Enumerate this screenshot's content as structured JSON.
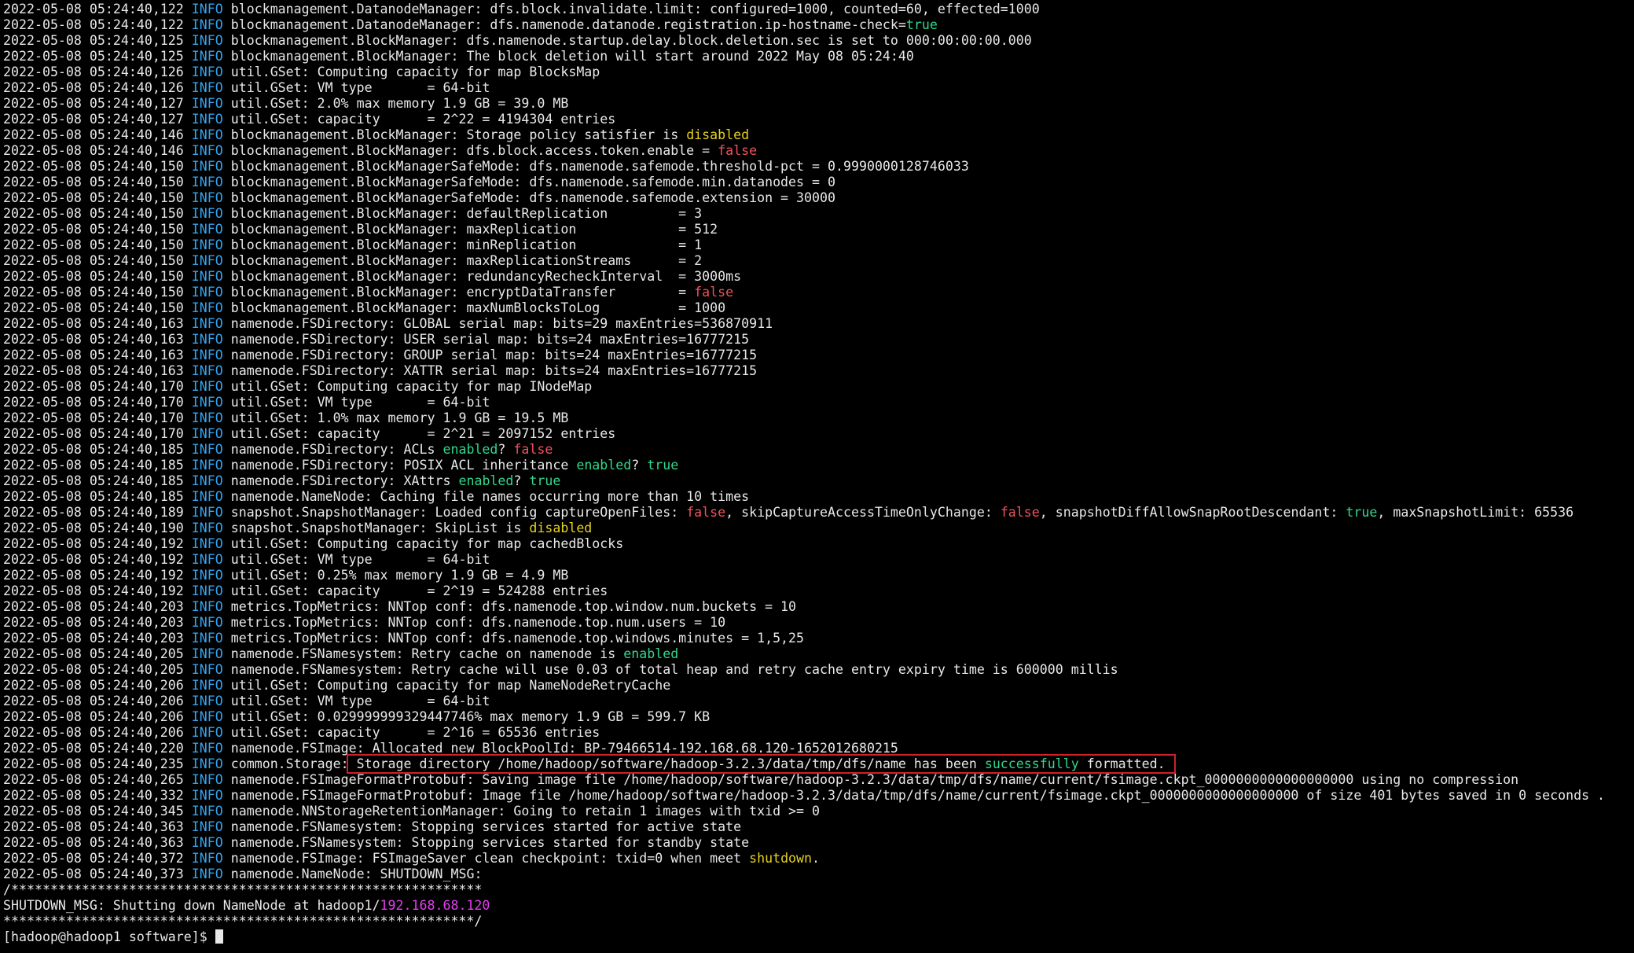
{
  "colors": {
    "background": "#000000",
    "text": "#e8e8e8",
    "level": "#35a4f0",
    "green": "#2fd88c",
    "red": "#f0525a",
    "yellow": "#e6d21f",
    "magenta": "#e33ef0",
    "highlight_box": "#d0202a"
  },
  "prompt": "[hadoop@hadoop1 software]$ ",
  "lines": [
    {
      "ts": "2022-05-08 05:24:40,122",
      "level": "INFO",
      "segs": [
        {
          "t": " blockmanagement.DatanodeManager: dfs.block.invalidate.limit: configured=1000, counted=60, effected=1000"
        }
      ]
    },
    {
      "ts": "2022-05-08 05:24:40,122",
      "level": "INFO",
      "segs": [
        {
          "t": " blockmanagement.DatanodeManager: dfs.namenode.datanode.registration.ip-hostname-check="
        },
        {
          "t": "true",
          "c": "green"
        }
      ]
    },
    {
      "ts": "2022-05-08 05:24:40,125",
      "level": "INFO",
      "segs": [
        {
          "t": " blockmanagement.BlockManager: dfs.namenode.startup.delay.block.deletion.sec is set to 000:00:00:00.000"
        }
      ]
    },
    {
      "ts": "2022-05-08 05:24:40,125",
      "level": "INFO",
      "segs": [
        {
          "t": " blockmanagement.BlockManager: The block deletion will start around 2022 May 08 05:24:40"
        }
      ]
    },
    {
      "ts": "2022-05-08 05:24:40,126",
      "level": "INFO",
      "segs": [
        {
          "t": " util.GSet: Computing capacity for map BlocksMap"
        }
      ]
    },
    {
      "ts": "2022-05-08 05:24:40,126",
      "level": "INFO",
      "segs": [
        {
          "t": " util.GSet: VM type       = 64-bit"
        }
      ]
    },
    {
      "ts": "2022-05-08 05:24:40,127",
      "level": "INFO",
      "segs": [
        {
          "t": " util.GSet: 2.0% max memory 1.9 GB = 39.0 MB"
        }
      ]
    },
    {
      "ts": "2022-05-08 05:24:40,127",
      "level": "INFO",
      "segs": [
        {
          "t": " util.GSet: capacity      = 2^22 = 4194304 entries"
        }
      ]
    },
    {
      "ts": "2022-05-08 05:24:40,146",
      "level": "INFO",
      "segs": [
        {
          "t": " blockmanagement.BlockManager: Storage policy satisfier is "
        },
        {
          "t": "disabled",
          "c": "yellow"
        }
      ]
    },
    {
      "ts": "2022-05-08 05:24:40,146",
      "level": "INFO",
      "segs": [
        {
          "t": " blockmanagement.BlockManager: dfs.block.access.token.enable = "
        },
        {
          "t": "false",
          "c": "red"
        }
      ]
    },
    {
      "ts": "2022-05-08 05:24:40,150",
      "level": "INFO",
      "segs": [
        {
          "t": " blockmanagement.BlockManagerSafeMode: dfs.namenode.safemode.threshold-pct = 0.9990000128746033"
        }
      ]
    },
    {
      "ts": "2022-05-08 05:24:40,150",
      "level": "INFO",
      "segs": [
        {
          "t": " blockmanagement.BlockManagerSafeMode: dfs.namenode.safemode.min.datanodes = 0"
        }
      ]
    },
    {
      "ts": "2022-05-08 05:24:40,150",
      "level": "INFO",
      "segs": [
        {
          "t": " blockmanagement.BlockManagerSafeMode: dfs.namenode.safemode.extension = 30000"
        }
      ]
    },
    {
      "ts": "2022-05-08 05:24:40,150",
      "level": "INFO",
      "segs": [
        {
          "t": " blockmanagement.BlockManager: defaultReplication         = 3"
        }
      ]
    },
    {
      "ts": "2022-05-08 05:24:40,150",
      "level": "INFO",
      "segs": [
        {
          "t": " blockmanagement.BlockManager: maxReplication             = 512"
        }
      ]
    },
    {
      "ts": "2022-05-08 05:24:40,150",
      "level": "INFO",
      "segs": [
        {
          "t": " blockmanagement.BlockManager: minReplication             = 1"
        }
      ]
    },
    {
      "ts": "2022-05-08 05:24:40,150",
      "level": "INFO",
      "segs": [
        {
          "t": " blockmanagement.BlockManager: maxReplicationStreams      = 2"
        }
      ]
    },
    {
      "ts": "2022-05-08 05:24:40,150",
      "level": "INFO",
      "segs": [
        {
          "t": " blockmanagement.BlockManager: redundancyRecheckInterval  = 3000ms"
        }
      ]
    },
    {
      "ts": "2022-05-08 05:24:40,150",
      "level": "INFO",
      "segs": [
        {
          "t": " blockmanagement.BlockManager: encryptDataTransfer        = "
        },
        {
          "t": "false",
          "c": "red"
        }
      ]
    },
    {
      "ts": "2022-05-08 05:24:40,150",
      "level": "INFO",
      "segs": [
        {
          "t": " blockmanagement.BlockManager: maxNumBlocksToLog          = 1000"
        }
      ]
    },
    {
      "ts": "2022-05-08 05:24:40,163",
      "level": "INFO",
      "segs": [
        {
          "t": " namenode.FSDirectory: GLOBAL serial map: bits=29 maxEntries=536870911"
        }
      ]
    },
    {
      "ts": "2022-05-08 05:24:40,163",
      "level": "INFO",
      "segs": [
        {
          "t": " namenode.FSDirectory: USER serial map: bits=24 maxEntries=16777215"
        }
      ]
    },
    {
      "ts": "2022-05-08 05:24:40,163",
      "level": "INFO",
      "segs": [
        {
          "t": " namenode.FSDirectory: GROUP serial map: bits=24 maxEntries=16777215"
        }
      ]
    },
    {
      "ts": "2022-05-08 05:24:40,163",
      "level": "INFO",
      "segs": [
        {
          "t": " namenode.FSDirectory: XATTR serial map: bits=24 maxEntries=16777215"
        }
      ]
    },
    {
      "ts": "2022-05-08 05:24:40,170",
      "level": "INFO",
      "segs": [
        {
          "t": " util.GSet: Computing capacity for map INodeMap"
        }
      ]
    },
    {
      "ts": "2022-05-08 05:24:40,170",
      "level": "INFO",
      "segs": [
        {
          "t": " util.GSet: VM type       = 64-bit"
        }
      ]
    },
    {
      "ts": "2022-05-08 05:24:40,170",
      "level": "INFO",
      "segs": [
        {
          "t": " util.GSet: 1.0% max memory 1.9 GB = 19.5 MB"
        }
      ]
    },
    {
      "ts": "2022-05-08 05:24:40,170",
      "level": "INFO",
      "segs": [
        {
          "t": " util.GSet: capacity      = 2^21 = 2097152 entries"
        }
      ]
    },
    {
      "ts": "2022-05-08 05:24:40,185",
      "level": "INFO",
      "segs": [
        {
          "t": " namenode.FSDirectory: ACLs "
        },
        {
          "t": "enabled",
          "c": "green"
        },
        {
          "t": "? "
        },
        {
          "t": "false",
          "c": "red"
        }
      ]
    },
    {
      "ts": "2022-05-08 05:24:40,185",
      "level": "INFO",
      "segs": [
        {
          "t": " namenode.FSDirectory: POSIX ACL inheritance "
        },
        {
          "t": "enabled",
          "c": "green"
        },
        {
          "t": "? "
        },
        {
          "t": "true",
          "c": "green"
        }
      ]
    },
    {
      "ts": "2022-05-08 05:24:40,185",
      "level": "INFO",
      "segs": [
        {
          "t": " namenode.FSDirectory: XAttrs "
        },
        {
          "t": "enabled",
          "c": "green"
        },
        {
          "t": "? "
        },
        {
          "t": "true",
          "c": "green"
        }
      ]
    },
    {
      "ts": "2022-05-08 05:24:40,185",
      "level": "INFO",
      "segs": [
        {
          "t": " namenode.NameNode: Caching file names occurring more than 10 times"
        }
      ]
    },
    {
      "ts": "2022-05-08 05:24:40,189",
      "level": "INFO",
      "segs": [
        {
          "t": " snapshot.SnapshotManager: Loaded config captureOpenFiles: "
        },
        {
          "t": "false",
          "c": "red"
        },
        {
          "t": ", skipCaptureAccessTimeOnlyChange: "
        },
        {
          "t": "false",
          "c": "red"
        },
        {
          "t": ", snapshotDiffAllowSnapRootDescendant: "
        },
        {
          "t": "true",
          "c": "green"
        },
        {
          "t": ", maxSnapshotLimit: 65536"
        }
      ]
    },
    {
      "ts": "2022-05-08 05:24:40,190",
      "level": "INFO",
      "segs": [
        {
          "t": " snapshot.SnapshotManager: SkipList is "
        },
        {
          "t": "disabled",
          "c": "yellow"
        }
      ]
    },
    {
      "ts": "2022-05-08 05:24:40,192",
      "level": "INFO",
      "segs": [
        {
          "t": " util.GSet: Computing capacity for map cachedBlocks"
        }
      ]
    },
    {
      "ts": "2022-05-08 05:24:40,192",
      "level": "INFO",
      "segs": [
        {
          "t": " util.GSet: VM type       = 64-bit"
        }
      ]
    },
    {
      "ts": "2022-05-08 05:24:40,192",
      "level": "INFO",
      "segs": [
        {
          "t": " util.GSet: 0.25% max memory 1.9 GB = 4.9 MB"
        }
      ]
    },
    {
      "ts": "2022-05-08 05:24:40,192",
      "level": "INFO",
      "segs": [
        {
          "t": " util.GSet: capacity      = 2^19 = 524288 entries"
        }
      ]
    },
    {
      "ts": "2022-05-08 05:24:40,203",
      "level": "INFO",
      "segs": [
        {
          "t": " metrics.TopMetrics: NNTop conf: dfs.namenode.top.window.num.buckets = 10"
        }
      ]
    },
    {
      "ts": "2022-05-08 05:24:40,203",
      "level": "INFO",
      "segs": [
        {
          "t": " metrics.TopMetrics: NNTop conf: dfs.namenode.top.num.users = 10"
        }
      ]
    },
    {
      "ts": "2022-05-08 05:24:40,203",
      "level": "INFO",
      "segs": [
        {
          "t": " metrics.TopMetrics: NNTop conf: dfs.namenode.top.windows.minutes = 1,5,25"
        }
      ]
    },
    {
      "ts": "2022-05-08 05:24:40,205",
      "level": "INFO",
      "segs": [
        {
          "t": " namenode.FSNamesystem: Retry cache on namenode is "
        },
        {
          "t": "enabled",
          "c": "green"
        }
      ]
    },
    {
      "ts": "2022-05-08 05:24:40,205",
      "level": "INFO",
      "segs": [
        {
          "t": " namenode.FSNamesystem: Retry cache will use 0.03 of total heap and retry cache entry expiry time is 600000 millis"
        }
      ]
    },
    {
      "ts": "2022-05-08 05:24:40,206",
      "level": "INFO",
      "segs": [
        {
          "t": " util.GSet: Computing capacity for map NameNodeRetryCache"
        }
      ]
    },
    {
      "ts": "2022-05-08 05:24:40,206",
      "level": "INFO",
      "segs": [
        {
          "t": " util.GSet: VM type       = 64-bit"
        }
      ]
    },
    {
      "ts": "2022-05-08 05:24:40,206",
      "level": "INFO",
      "segs": [
        {
          "t": " util.GSet: 0.029999999329447746% max memory 1.9 GB = 599.7 KB"
        }
      ]
    },
    {
      "ts": "2022-05-08 05:24:40,206",
      "level": "INFO",
      "segs": [
        {
          "t": " util.GSet: capacity      = 2^16 = 65536 entries"
        }
      ]
    },
    {
      "ts": "2022-05-08 05:24:40,220",
      "level": "INFO",
      "segs": [
        {
          "t": " namenode.FSImage: Allocated new BlockPoolId: BP-79466514-192.168.68.120-1652012680215"
        }
      ]
    },
    {
      "ts": "2022-05-08 05:24:40,235",
      "level": "INFO",
      "segs": [
        {
          "t": " common.Storage:"
        },
        {
          "t": " Storage directory /home/hadoop/software/hadoop-3.2.3/data/tmp/dfs/name has been ",
          "hl": "start"
        },
        {
          "t": "successfully",
          "c": "green",
          "hl": "mid"
        },
        {
          "t": " formatted. ",
          "hl": "end"
        }
      ]
    },
    {
      "ts": "2022-05-08 05:24:40,265",
      "level": "INFO",
      "segs": [
        {
          "t": " namenode.FSImageFormatProtobuf: Saving image file /home/hadoop/software/hadoop-3.2.3/data/tmp/dfs/name/current/fsimage.ckpt_0000000000000000000 using no compression"
        }
      ]
    },
    {
      "ts": "2022-05-08 05:24:40,332",
      "level": "INFO",
      "segs": [
        {
          "t": " namenode.FSImageFormatProtobuf: Image file /home/hadoop/software/hadoop-3.2.3/data/tmp/dfs/name/current/fsimage.ckpt_0000000000000000000 of size 401 bytes saved in 0 seconds ."
        }
      ]
    },
    {
      "ts": "2022-05-08 05:24:40,345",
      "level": "INFO",
      "segs": [
        {
          "t": " namenode.NNStorageRetentionManager: Going to retain 1 images with txid >= 0"
        }
      ]
    },
    {
      "ts": "2022-05-08 05:24:40,363",
      "level": "INFO",
      "segs": [
        {
          "t": " namenode.FSNamesystem: Stopping services started for active state"
        }
      ]
    },
    {
      "ts": "2022-05-08 05:24:40,363",
      "level": "INFO",
      "segs": [
        {
          "t": " namenode.FSNamesystem: Stopping services started for standby state"
        }
      ]
    },
    {
      "ts": "2022-05-08 05:24:40,372",
      "level": "INFO",
      "segs": [
        {
          "t": " namenode.FSImage: FSImageSaver clean checkpoint: txid=0 when meet "
        },
        {
          "t": "shutdown",
          "c": "yellow"
        },
        {
          "t": "."
        }
      ]
    },
    {
      "ts": "2022-05-08 05:24:40,373",
      "level": "INFO",
      "segs": [
        {
          "t": " namenode.NameNode: SHUTDOWN_MSG:"
        }
      ]
    },
    {
      "ts": "",
      "level": "",
      "segs": [
        {
          "t": "/************************************************************"
        }
      ]
    },
    {
      "ts": "",
      "level": "",
      "segs": [
        {
          "t": "SHUTDOWN_MSG: Shutting down NameNode at hadoop1/"
        },
        {
          "t": "192.168.68.120",
          "c": "magenta"
        }
      ]
    },
    {
      "ts": "",
      "level": "",
      "segs": [
        {
          "t": "************************************************************/"
        }
      ]
    }
  ]
}
